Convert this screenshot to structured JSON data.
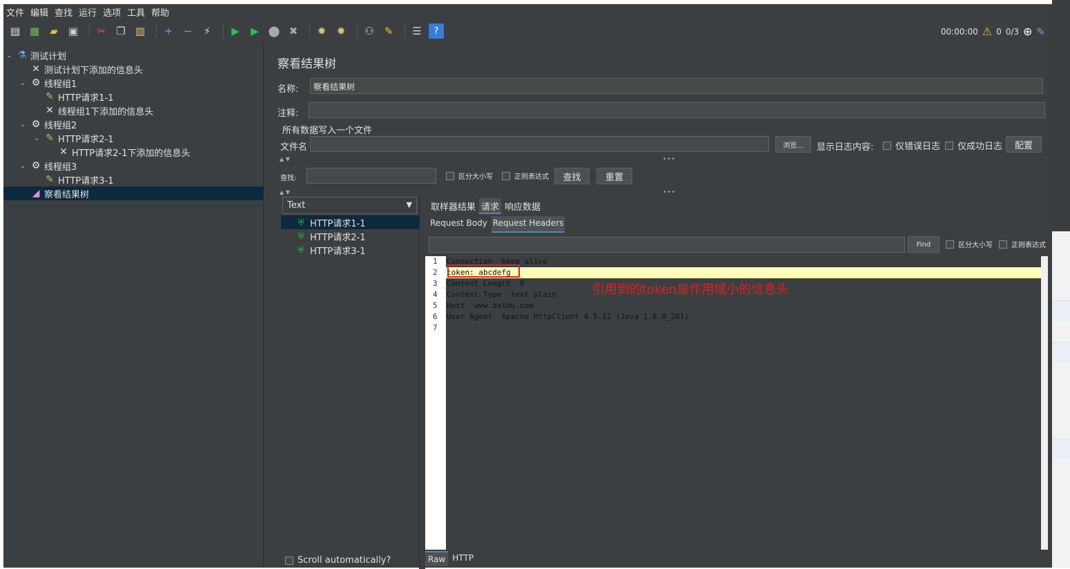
{
  "menu": [
    "文件",
    "编辑",
    "查找",
    "运行",
    "选项",
    "工具",
    "帮助"
  ],
  "toolbar_status": {
    "timer": "00:00:00",
    "warnings": "0",
    "threads": "0/3"
  },
  "tree": [
    {
      "label": "测试计划",
      "icon": "flask-icon",
      "level": 0,
      "toggle": "⌄"
    },
    {
      "label": "测试计划下添加的信息头",
      "icon": "tools-icon",
      "level": 1,
      "toggle": ""
    },
    {
      "label": "线程组1",
      "icon": "gear-icon",
      "level": 1,
      "toggle": "⌄"
    },
    {
      "label": "HTTP请求1-1",
      "icon": "pipette-icon",
      "level": 2,
      "toggle": ""
    },
    {
      "label": "线程组1下添加的信息头",
      "icon": "tools-icon",
      "level": 2,
      "toggle": ""
    },
    {
      "label": "线程组2",
      "icon": "gear-icon",
      "level": 1,
      "toggle": "⌄"
    },
    {
      "label": "HTTP请求2-1",
      "icon": "pipette-icon",
      "level": 2,
      "toggle": "⌄"
    },
    {
      "label": "HTTP请求2-1下添加的信息头",
      "icon": "tools-icon",
      "level": 3,
      "toggle": ""
    },
    {
      "label": "线程组3",
      "icon": "gear-icon",
      "level": 1,
      "toggle": "⌄"
    },
    {
      "label": "HTTP请求3-1",
      "icon": "pipette-icon",
      "level": 2,
      "toggle": ""
    },
    {
      "label": "察看结果树",
      "icon": "chart-icon",
      "level": 1,
      "toggle": "",
      "selected": true
    }
  ],
  "panel": {
    "title": "察看结果树",
    "name_label": "名称:",
    "name_value": "察看结果树",
    "comment_label": "注释:",
    "comment_value": "",
    "file_section": "所有数据写入一个文件",
    "filename_label": "文件名",
    "filename_value": "",
    "browse_button": "浏览...",
    "log_label": "显示日志内容:",
    "errors_only": "仅错误日志",
    "success_only": "仅成功日志",
    "config_button": "配置"
  },
  "search": {
    "label": "查找:",
    "value": "",
    "case_sensitive": "区分大小写",
    "regex": "正则表达式",
    "find_button": "查找",
    "reset_button": "重置"
  },
  "renderer": {
    "selected": "Text"
  },
  "results": [
    "HTTP请求1-1",
    "HTTP请求2-1",
    "HTTP请求3-1"
  ],
  "scroll_auto": "Scroll automatically?",
  "result_tabs": [
    "取样器结果",
    "请求",
    "响应数据"
  ],
  "request_tabs": [
    "Request Body",
    "Request Headers"
  ],
  "header_search": {
    "value": "",
    "find": "Find",
    "case": "区分大小写",
    "regex": "正则表达式"
  },
  "code_lines": [
    "Connection  keep alive",
    "token: abcdefg",
    "Content Length  0",
    "Content Type  text plain",
    "Host  www.baidu.com",
    "User Agent  Apache HttpClient 4.5.12 (Java 1.8.0_281)",
    ""
  ],
  "line_numbers": [
    "1",
    "2",
    "3",
    "4",
    "5",
    "6",
    "7"
  ],
  "annotation": "引用到的token是作用域小的信息头",
  "bottom_tabs": [
    "Raw",
    "HTTP"
  ]
}
